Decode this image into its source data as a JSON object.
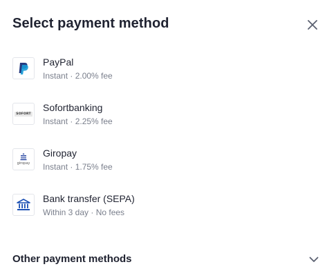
{
  "header": {
    "title": "Select payment method",
    "close_icon": "close-icon"
  },
  "methods": [
    {
      "name": "PayPal",
      "detail": "Instant · 2.00% fee",
      "icon": "paypal-logo"
    },
    {
      "name": "Sofortbanking",
      "detail": "Instant · 2.25% fee",
      "icon": "sofort-logo",
      "logo_text": "SOFORT"
    },
    {
      "name": "Giropay",
      "detail": "Instant · 1.75% fee",
      "icon": "giropay-logo",
      "logo_text": "giropay"
    },
    {
      "name": "Bank transfer (SEPA)",
      "detail": "Within 3 day · No fees",
      "icon": "bank-icon"
    }
  ],
  "other": {
    "label": "Other payment methods",
    "icon": "chevron-down-icon"
  },
  "colors": {
    "text": "#1f2230",
    "muted": "#7a7f8c",
    "paypal_dark": "#253b80",
    "paypal_light": "#179bd7",
    "bank_blue": "#1a4fb4"
  }
}
